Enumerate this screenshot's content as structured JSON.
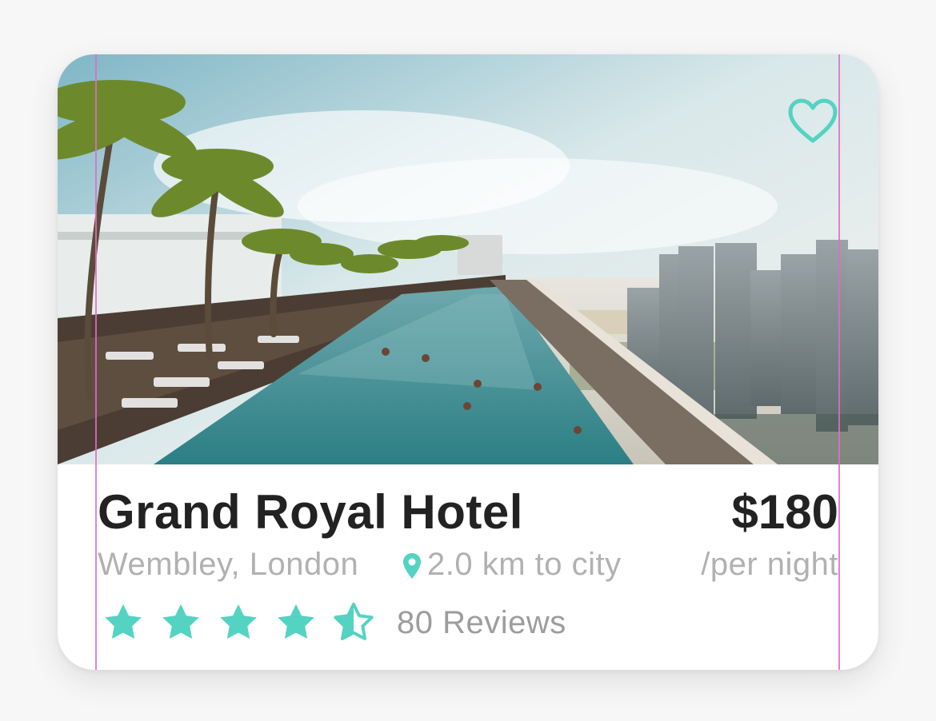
{
  "hotel": {
    "name": "Grand Royal Hotel",
    "location": "Wembley, London",
    "distance": "2.0 km to city",
    "price": "$180",
    "price_unit": "/per night",
    "rating": 4.5,
    "rating_max": 5,
    "reviews": "80 Reviews"
  },
  "icons": {
    "favorite": "heart-outline-icon",
    "location": "map-pin-icon",
    "star_full": "star-icon",
    "star_half": "star-half-icon"
  },
  "colors": {
    "accent": "#54d3c2",
    "title": "#222222",
    "muted": "#b1b1b1",
    "guide": "#e06cc6"
  }
}
